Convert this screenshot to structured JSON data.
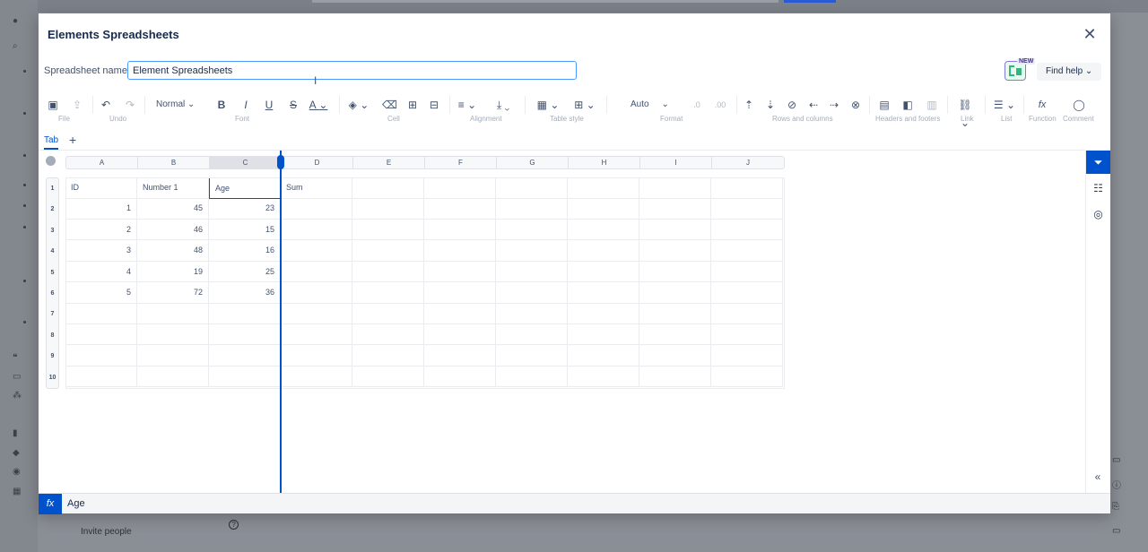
{
  "modal": {
    "title": "Elements Spreadsheets",
    "close_glyph": "✕"
  },
  "spreadsheet_name": {
    "label": "Spreadsheet name",
    "value": "Element Spreadsheets"
  },
  "header_actions": {
    "new_badge": "NEW",
    "find_help": "Find help ⌄"
  },
  "toolbar": {
    "groups": {
      "file": "File",
      "undo": "Undo",
      "font": "Font",
      "cell": "Cell",
      "alignment": "Alignment",
      "table_style": "Table style",
      "format": "Format",
      "rows_columns": "Rows and columns",
      "headers_footers": "Headers and footers",
      "link": "Link",
      "list": "List",
      "function": "Function",
      "comment": "Comment"
    },
    "text_style": "Normal",
    "number_format": "Auto",
    "caret": "⌄",
    "bold": "B",
    "italic": "I",
    "underline": "U",
    "strike": "S",
    "font_color": "A",
    "fx": "fx"
  },
  "tabs": [
    {
      "label": "Tab"
    }
  ],
  "add_tab": "+",
  "columns": [
    "A",
    "B",
    "C",
    "D",
    "E",
    "F",
    "G",
    "H",
    "I",
    "J"
  ],
  "rows": [
    "1",
    "2",
    "3",
    "4",
    "5",
    "6",
    "7",
    "8",
    "9",
    "10"
  ],
  "cells": {
    "header": [
      "ID",
      "Number 1",
      "Age",
      "Sum"
    ],
    "data": [
      [
        "1",
        "45",
        "23"
      ],
      [
        "2",
        "46",
        "15"
      ],
      [
        "3",
        "48",
        "16"
      ],
      [
        "4",
        "19",
        "25"
      ],
      [
        "5",
        "72",
        "36"
      ]
    ]
  },
  "selected_column": "C",
  "formula_bar": {
    "fx": "fx",
    "value": "Age"
  },
  "side_panel": {
    "collapse": "«"
  },
  "background": {
    "invite_people": "Invite people",
    "help_glyph": "?"
  },
  "colors": {
    "accent": "#0052cc",
    "input_focus": "#4c9aff"
  }
}
